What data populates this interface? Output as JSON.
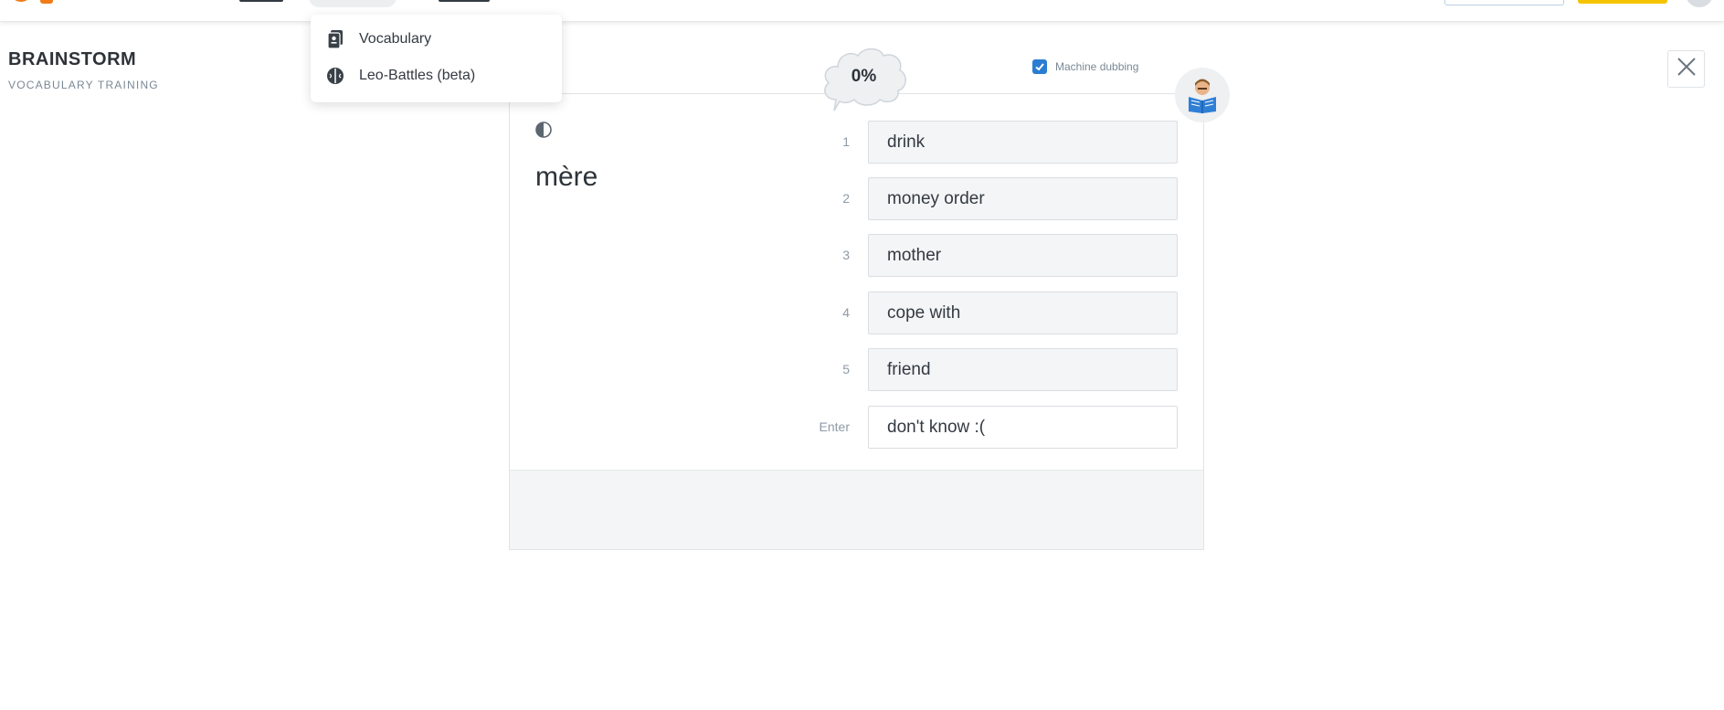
{
  "menu": {
    "items": [
      {
        "label": "Vocabulary",
        "icon": "vocabulary-cards-icon"
      },
      {
        "label": "Leo-Battles (beta)",
        "icon": "brain-icon"
      }
    ]
  },
  "header": {
    "title": "BRAINSTORM",
    "subtitle": "VOCABULARY TRAINING",
    "close_icon": "close-icon"
  },
  "dubbing": {
    "label": "Machine dubbing",
    "checked": true
  },
  "progress": {
    "label": "0%",
    "value": 0
  },
  "quiz": {
    "word": "mère",
    "options": [
      {
        "key": "1",
        "text": "drink"
      },
      {
        "key": "2",
        "text": "money order"
      },
      {
        "key": "3",
        "text": "mother"
      },
      {
        "key": "4",
        "text": "cope with"
      },
      {
        "key": "5",
        "text": "friend"
      },
      {
        "key": "Enter",
        "text": "don't know :("
      }
    ]
  },
  "colors": {
    "accent": "#2a7dd1",
    "brand": "#f07c17",
    "premium": "#f5c400"
  }
}
